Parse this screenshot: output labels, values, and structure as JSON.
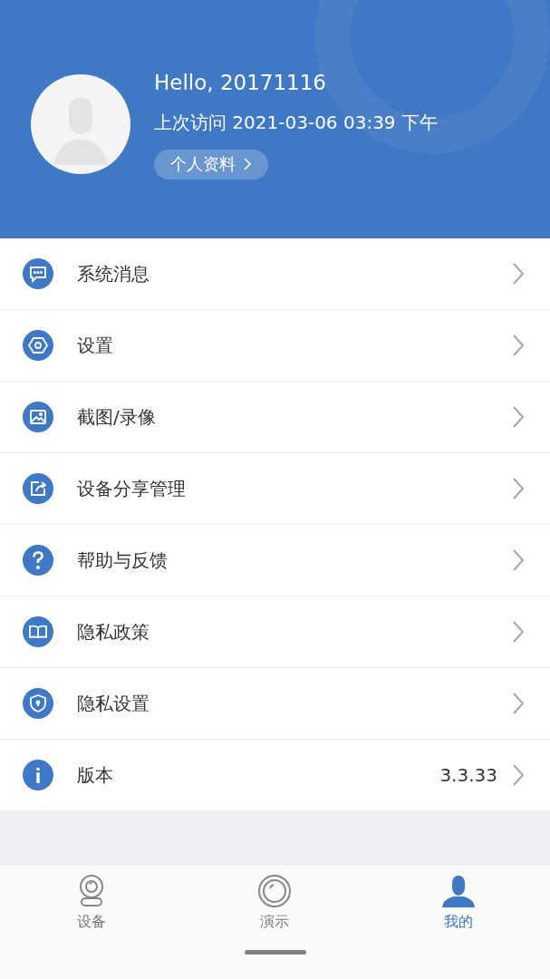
{
  "profile": {
    "greeting": "Hello, 20171116",
    "last_visit": "上次访问 2021-03-06 03:39 下午",
    "profile_button": "个人资料"
  },
  "menu": [
    {
      "kind": "message",
      "label": "系统消息"
    },
    {
      "kind": "settings",
      "label": "设置"
    },
    {
      "kind": "image",
      "label": "截图/录像"
    },
    {
      "kind": "share",
      "label": "设备分享管理"
    },
    {
      "kind": "help",
      "label": "帮助与反馈"
    },
    {
      "kind": "book",
      "label": "隐私政策"
    },
    {
      "kind": "shield",
      "label": "隐私设置"
    },
    {
      "kind": "info",
      "label": "版本",
      "value": "3.3.33"
    }
  ],
  "tab_bar": [
    {
      "kind": "camera",
      "label": "设备",
      "selected": false
    },
    {
      "kind": "lens",
      "label": "演示",
      "selected": false
    },
    {
      "kind": "person",
      "label": "我的",
      "selected": true
    }
  ]
}
